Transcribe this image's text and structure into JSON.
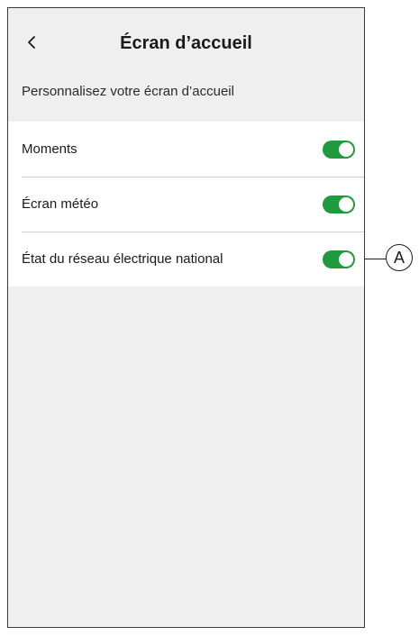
{
  "header": {
    "back_icon": "chevron-left-icon",
    "title": "Écran d’accueil"
  },
  "subtitle": "Personnalisez votre écran d’accueil",
  "settings": [
    {
      "label": "Moments",
      "enabled": true
    },
    {
      "label": "Écran météo",
      "enabled": true
    },
    {
      "label": "État du réseau électrique national",
      "enabled": true
    }
  ],
  "callout": {
    "label": "A"
  },
  "colors": {
    "toggle_on": "#1f9a3c",
    "background": "#efefef",
    "card": "#ffffff"
  }
}
